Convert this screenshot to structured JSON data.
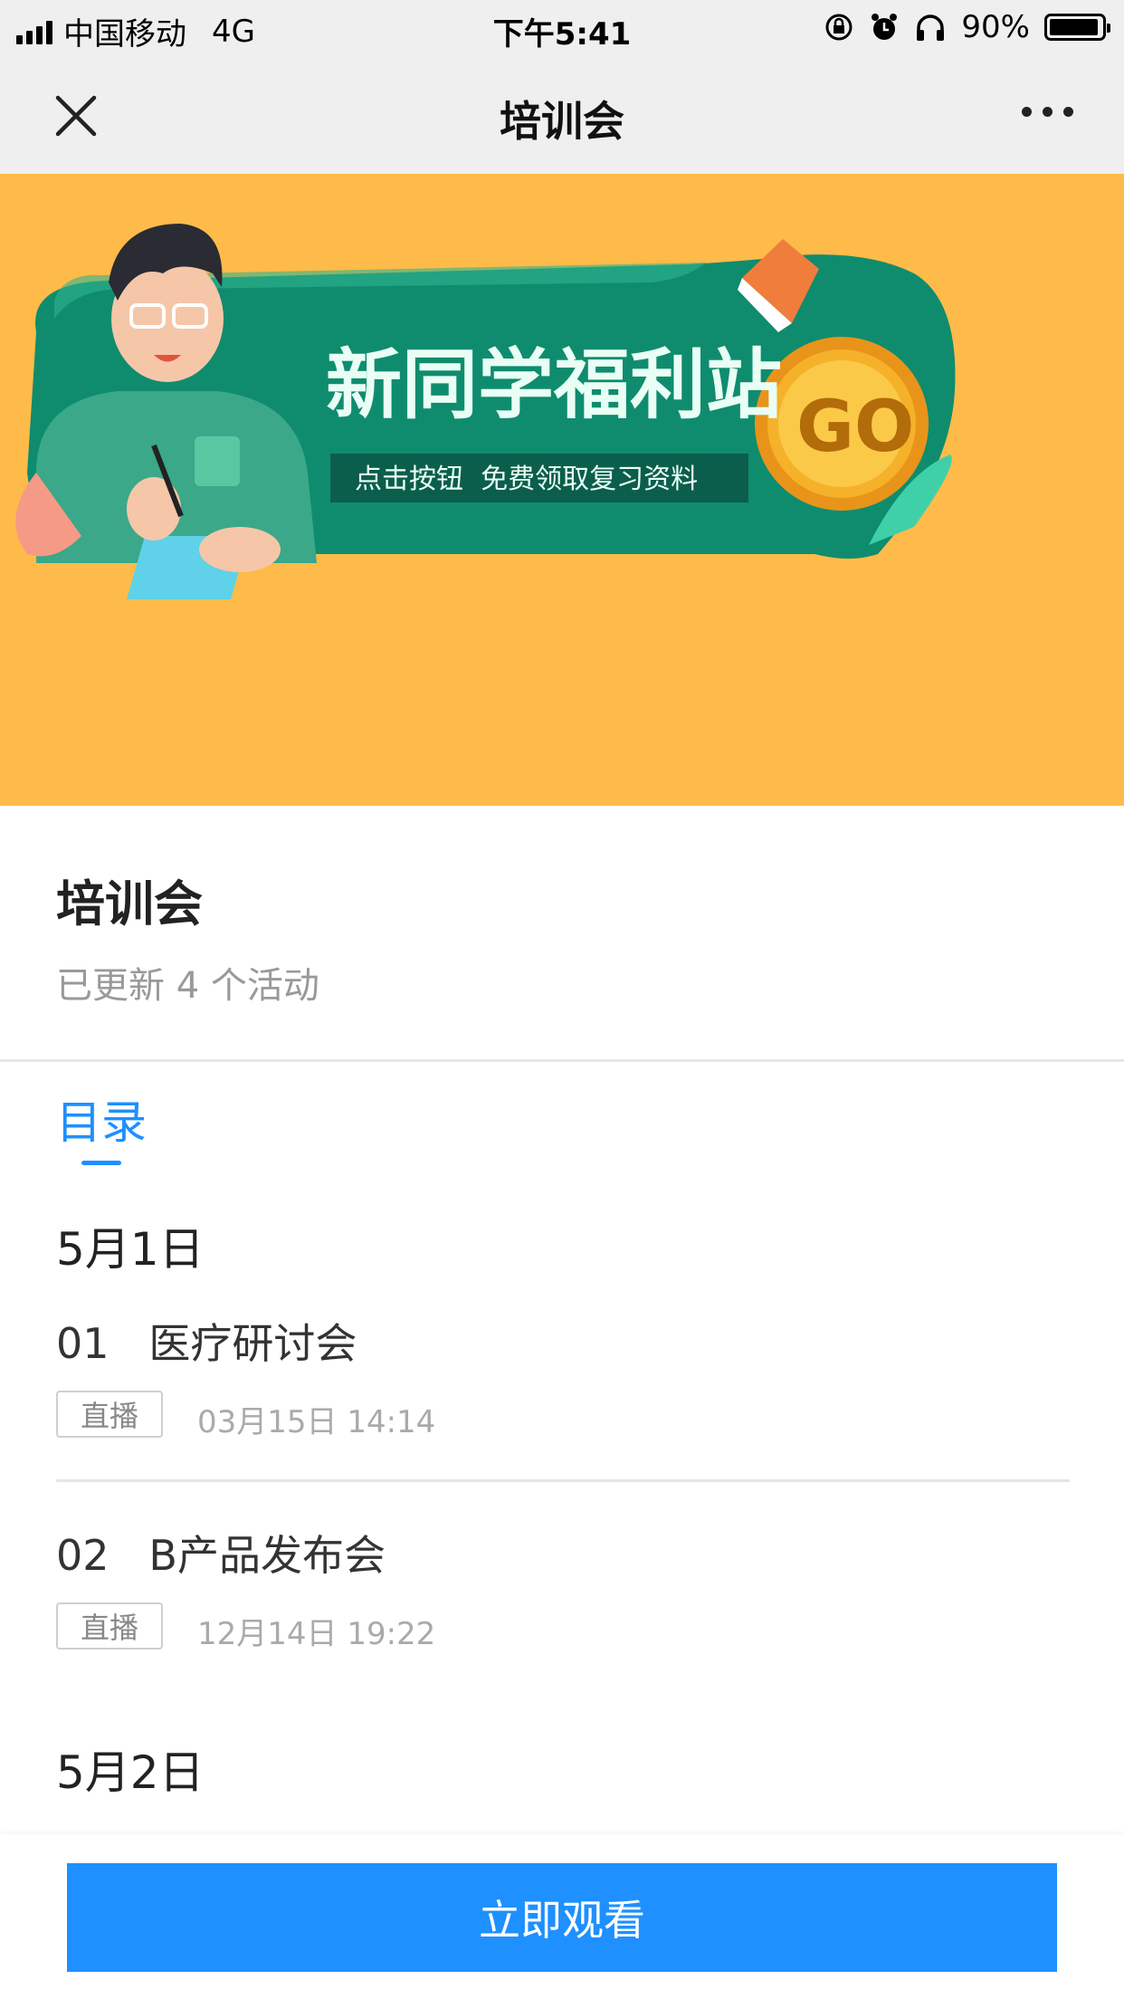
{
  "status_bar": {
    "carrier": "中国移动",
    "network": "4G",
    "time": "下午5:41",
    "battery_percent": "90%",
    "battery_level": 0.9
  },
  "nav": {
    "title": "培训会"
  },
  "banner": {
    "headline": "新同学福利站",
    "subline": "点击按钮  免费领取复习资料",
    "go_label": "GO",
    "colors": {
      "background": "#ffbb4a",
      "pill": "#0f8c6e",
      "coin": "#f5a623"
    }
  },
  "header": {
    "title": "培训会",
    "subtitle": "已更新 4 个活动"
  },
  "tabs": {
    "catalog_label": "目录"
  },
  "sections": [
    {
      "date": "5月1日",
      "items": [
        {
          "index": "01",
          "title": "医疗研讨会",
          "tag": "直播",
          "time": "03月15日 14:14"
        },
        {
          "index": "02",
          "title": "B产品发布会",
          "tag": "直播",
          "time": "12月14日 19:22"
        }
      ]
    },
    {
      "date": "5月2日",
      "items": []
    }
  ],
  "footer": {
    "watch_label": "立即观看",
    "accent": "#1e90ff"
  }
}
